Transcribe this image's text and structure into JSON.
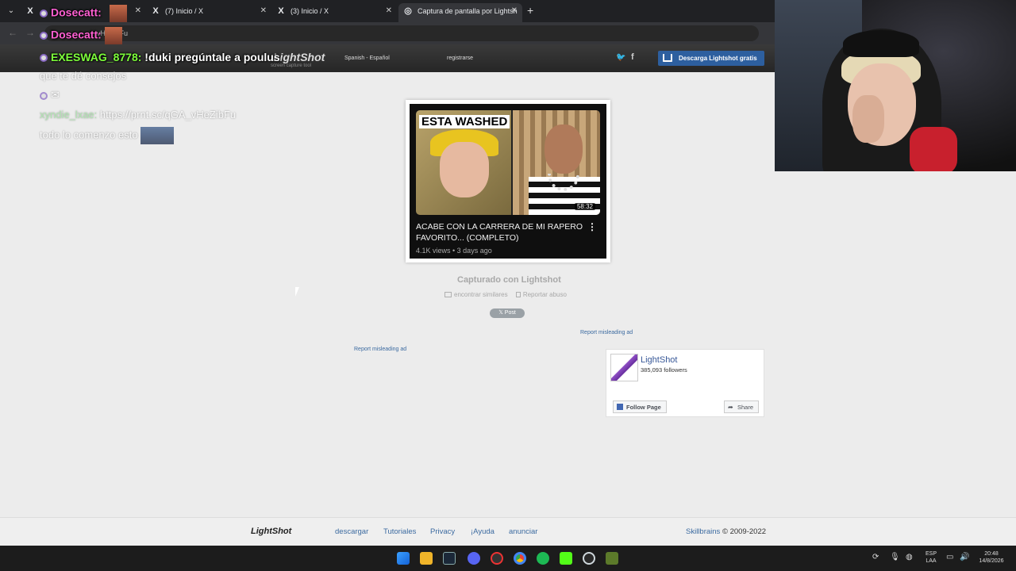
{
  "browser": {
    "tabs": [
      {
        "label": "",
        "favicon": "X"
      },
      {
        "label": "(7) Inicio / X",
        "favicon": "X"
      },
      {
        "label": "(3) Inicio / X",
        "favicon": "X"
      },
      {
        "label": "Captura de pantalla por Lightsh",
        "favicon": "globe"
      }
    ],
    "url": "vHeZibFu"
  },
  "header": {
    "logo": "LightShot",
    "logo_sub": "screen capture tool",
    "language": "Spanish - Español",
    "register": "registrarse",
    "download": "Descarga Lightshot gratis"
  },
  "screenshot": {
    "thumb_text": "ESTA WASHED",
    "duration": "58:32",
    "title": "ACABE CON LA CARRERA DE MI RAPERO FAVORITO... (COMPLETO)",
    "meta": "4.1K views • 3 days ago"
  },
  "captured_label": "Capturado con Lightshot",
  "find_similar": "encontrar similares",
  "report_abuse": "Reportar abuso",
  "post_button": "Post",
  "ad_link_1": "Report misleading ad",
  "ad_link_2": "Report misleading ad",
  "fb_widget": {
    "name": "LightShot",
    "followers": "385,093 followers",
    "follow": "Follow Page",
    "share": "Share"
  },
  "footer": {
    "logo": "LightShot",
    "links": [
      "descargar",
      "Tutoriales",
      "Privacy",
      "¡Ayuda",
      "anunciar"
    ],
    "brand": "Skillbrains",
    "copyright": "© 2009-2022"
  },
  "taskbar": {
    "lang_top": "ESP",
    "lang_bottom": "LAA",
    "time": "20:48",
    "date": "14/8/2026"
  },
  "chat": {
    "line1_user": "Dosecatt:",
    "line2_user": "Dosecatt:",
    "line3_user": "EXESWAG_8778:",
    "line3_text": "!duki pregúntale a poulus",
    "line4_text": "que te dé consejos",
    "line6_user": "xyndie_lxae:",
    "line6_text": "https://prnt.sc/qGA_vHeZibFu",
    "line7_text": "todo lo comenzo esto"
  }
}
